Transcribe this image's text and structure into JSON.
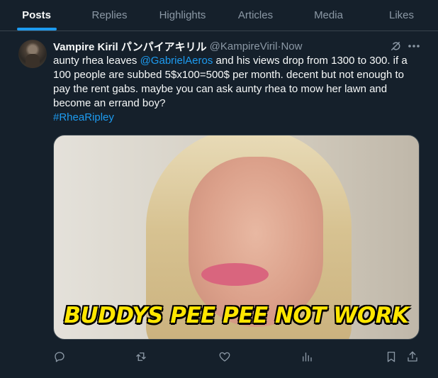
{
  "tabs": [
    {
      "label": "Posts",
      "active": true
    },
    {
      "label": "Replies",
      "active": false
    },
    {
      "label": "Highlights",
      "active": false
    },
    {
      "label": "Articles",
      "active": false
    },
    {
      "label": "Media",
      "active": false
    },
    {
      "label": "Likes",
      "active": false
    }
  ],
  "post": {
    "display_name": "Vampire Kiril パンパイアキリル",
    "handle": "@KampireViril",
    "separator": " · ",
    "time": "Now",
    "text_part1": "aunty rhea leaves ",
    "mention": "@GabrielAeros",
    "text_part2": " and his views drop from 1300 to 300. if a 100 people are subbed 5$x100=500$ per month. decent but not enough to pay the rent gabs. maybe you can ask aunty rhea to mow her lawn and become an errand boy?",
    "hashtag": "#RheaRipley",
    "media_caption": "BUDDYS PEE PEE NOT WORK"
  },
  "icons": {
    "grok": "grok-icon",
    "more": "more-icon",
    "reply": "reply-icon",
    "repost": "repost-icon",
    "like": "like-icon",
    "views": "views-icon",
    "bookmark": "bookmark-icon",
    "share": "share-icon"
  },
  "colors": {
    "background": "#15202b",
    "accent": "#1d9bf0",
    "muted": "#8b98a5",
    "caption": "#ffe600"
  }
}
